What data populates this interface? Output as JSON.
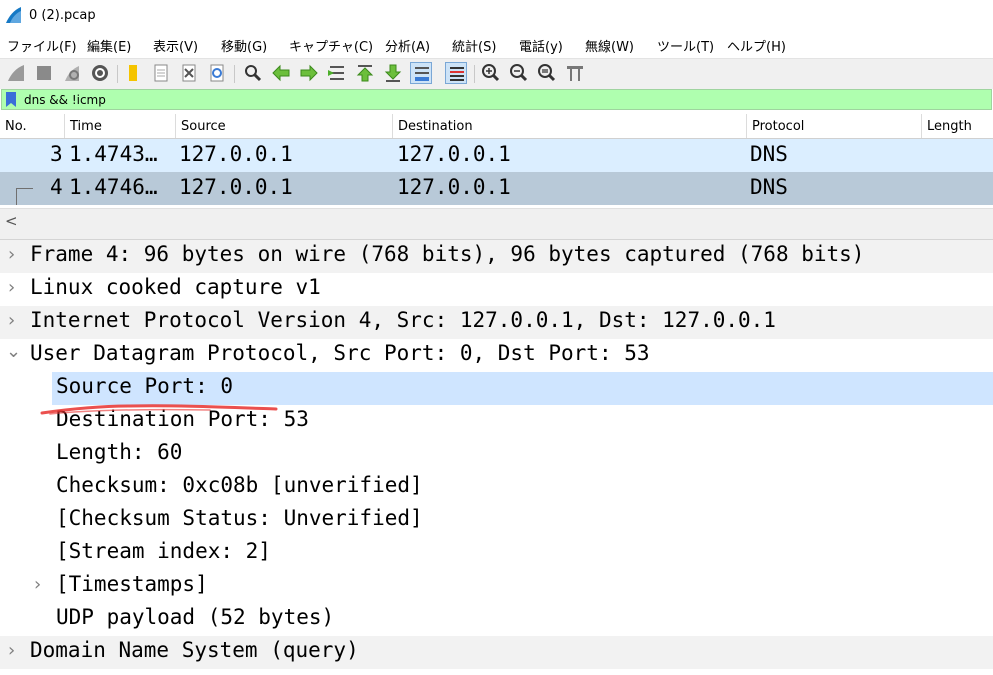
{
  "window": {
    "title": "0 (2).pcap"
  },
  "menu": [
    "ファイル(F)",
    "編集(E)",
    "表示(V)",
    "移動(G)",
    "キャプチャ(C)",
    "分析(A)",
    "統計(S)",
    "電話(y)",
    "無線(W)",
    "ツール(T)",
    "ヘルプ(H)"
  ],
  "toolbar": {
    "icons": [
      "shark-fin-start-icon",
      "stop-icon",
      "restart-icon",
      "options-gear-icon",
      "open-folder-icon",
      "save-file-icon",
      "close-file-icon",
      "reload-icon",
      "find-icon",
      "back-arrow-icon",
      "forward-arrow-icon",
      "go-to-packet-icon",
      "first-packet-icon",
      "last-packet-icon",
      "autoscroll-icon",
      "colorize-icon",
      "zoom-in-icon",
      "zoom-out-icon",
      "zoom-normal-icon",
      "resize-columns-icon"
    ]
  },
  "filter": {
    "value": "dns && !icmp"
  },
  "packet_list": {
    "columns": [
      "No.",
      "Time",
      "Source",
      "Destination",
      "Protocol",
      "Length"
    ],
    "rows": [
      {
        "no": "3",
        "time": "1.4743…",
        "source": "127.0.0.1",
        "destination": "127.0.0.1",
        "protocol": "DNS"
      },
      {
        "no": "4",
        "time": "1.4746…",
        "source": "127.0.0.1",
        "destination": "127.0.0.1",
        "protocol": "DNS"
      }
    ]
  },
  "details": [
    {
      "text": "Frame 4: 96 bytes on wire (768 bits), 96 bytes captured (768 bits)",
      "expander": "›"
    },
    {
      "text": "Linux cooked capture v1",
      "expander": "›"
    },
    {
      "text": "Internet Protocol Version 4, Src: 127.0.0.1, Dst: 127.0.0.1",
      "expander": "›"
    },
    {
      "text": "User Datagram Protocol, Src Port: 0, Dst Port: 53",
      "expander": "⌄"
    },
    {
      "text": "Source Port: 0"
    },
    {
      "text": "Destination Port: 53"
    },
    {
      "text": "Length: 60"
    },
    {
      "text": "Checksum: 0xc08b [unverified]"
    },
    {
      "text": "[Checksum Status: Unverified]"
    },
    {
      "text": "[Stream index: 2]"
    },
    {
      "text": "[Timestamps]",
      "expander": "›"
    },
    {
      "text": "UDP payload (52 bytes)"
    },
    {
      "text": "Domain Name System (query)",
      "expander": "›"
    }
  ],
  "colors": {
    "filter_bg": "#afffaf",
    "row_selected": "#b8c9d8",
    "row_hover": "#dbeeff",
    "annotation": "#e8312f"
  }
}
